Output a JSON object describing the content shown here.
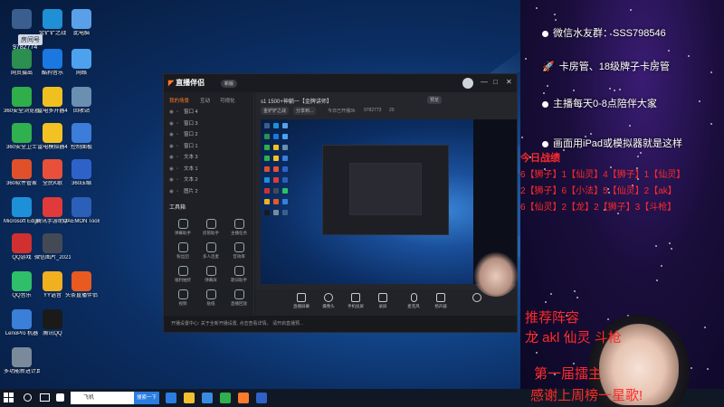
{
  "desktop": {
    "icons": [
      {
        "label": "",
        "color": "#3a5f8f"
      },
      {
        "label": "金铲铲之战",
        "color": "#1f8fd6"
      },
      {
        "label": "此电脑",
        "color": "#5aa0e8"
      },
      {
        "label": "网页摄出",
        "color": "#2a8f4f"
      },
      {
        "label": "酷狗音乐",
        "color": "#1a78e0"
      },
      {
        "label": "网络",
        "color": "#4da2f0"
      },
      {
        "label": "360安全浏览器",
        "color": "#2fae4a"
      },
      {
        "label": "雷电多开器4",
        "color": "#f0c020"
      },
      {
        "label": "回收站",
        "color": "#6a8fb0"
      },
      {
        "label": "360安全卫士",
        "color": "#30b04e"
      },
      {
        "label": "雷电模拟器4",
        "color": "#f2c225"
      },
      {
        "label": "控制面板",
        "color": "#3b7dd8"
      },
      {
        "label": "360软件管家",
        "color": "#e0502a"
      },
      {
        "label": "全民K歌",
        "color": "#e8503a"
      },
      {
        "label": "360压缩",
        "color": "#2f62c8"
      },
      {
        "label": "Microsoft Edge",
        "color": "#1e90d8"
      },
      {
        "label": "腾讯手游助手",
        "color": "#e03a3a"
      },
      {
        "label": "DAEMON Tools Lite",
        "color": "#2b5fb8"
      },
      {
        "label": "QQ游戏",
        "color": "#d03030"
      },
      {
        "label": "微信图片_2021091...",
        "color": "#444a55"
      },
      {
        "label": "QQ音乐",
        "color": "#2fbf6a"
      },
      {
        "label": "YY语音",
        "color": "#f0b020"
      },
      {
        "label": "头条直播伴侣",
        "color": "#e85a20"
      },
      {
        "label": "LenoPro 机器",
        "color": "#3a7fd8"
      },
      {
        "label": "腾讯QQ",
        "color": "#1a1a1a"
      },
      {
        "label": "多功能新进计算器",
        "color": "#7a8a9a"
      }
    ],
    "top_badges": {
      "room_label": "房间号",
      "room_number": "9782774"
    }
  },
  "app": {
    "logo": "直播伴侣",
    "badge": "新版",
    "window_controls": [
      "—",
      "□",
      "✕"
    ],
    "left_tabs": [
      "我的场景",
      "互动",
      "可视化"
    ],
    "layers": [
      "窗口 4",
      "窗口 3",
      "窗口 2",
      "窗口 1",
      "文本 3",
      "文本 1",
      "文本 2",
      "图片 2"
    ],
    "tools_title": "工具箱",
    "tools": [
      "弹幕助手",
      "房管助手",
      "主播任务",
      "粉丝团",
      "多人连麦",
      "音效库",
      "福利抽奖",
      "弹幕屏",
      "歌词助手",
      "视频",
      "贴纸",
      "直播回放"
    ],
    "stream_title": "s1 1500+神躺一【金牌讲师】",
    "stream_tag": "预览",
    "chips": [
      "金铲铲之战",
      "分享到..."
    ],
    "stats": [
      "今日已开播3h",
      "9782773",
      "20"
    ],
    "bottom_buttons": [
      "直播屏幕",
      "摄像头",
      "手机投屏",
      "录屏",
      "麦克风",
      "扬声器"
    ],
    "footer_text": "开播设置中心: 关于全新开播设置, 点击查看详情。    请开启直播预..."
  },
  "taskbar": {
    "search_placeholder": "飞机",
    "search_button": "搜索一下",
    "icon_colors": [
      "#2b7de1",
      "#f5c030",
      "#3a8be0",
      "#30b04e",
      "#ff7a2a",
      "#2f62c8"
    ]
  },
  "overlay": {
    "lines": [
      "微信水友群：SSS798546",
      "卡房管、18级牌子卡房管",
      "主播每天0-8点陪伴大家",
      "画面用iPad或模拟器就是这样"
    ],
    "battle_title": "今日战绩",
    "battle_rows": [
      "6【狮子】1【仙灵】4【狮子】1【仙灵】",
      "2【狮子】6【小法】5【仙灵】2【ak】",
      "6【仙灵】2【龙】2【狮子】3【斗枪】"
    ],
    "lineup_title": "推荐阵容",
    "lineup_units": "龙 akl 仙灵 斗枪",
    "king_line": "第一届擂主",
    "thanks_line": "感谢上周榜一星歌!",
    "accent_color": "#ff2a2a"
  }
}
